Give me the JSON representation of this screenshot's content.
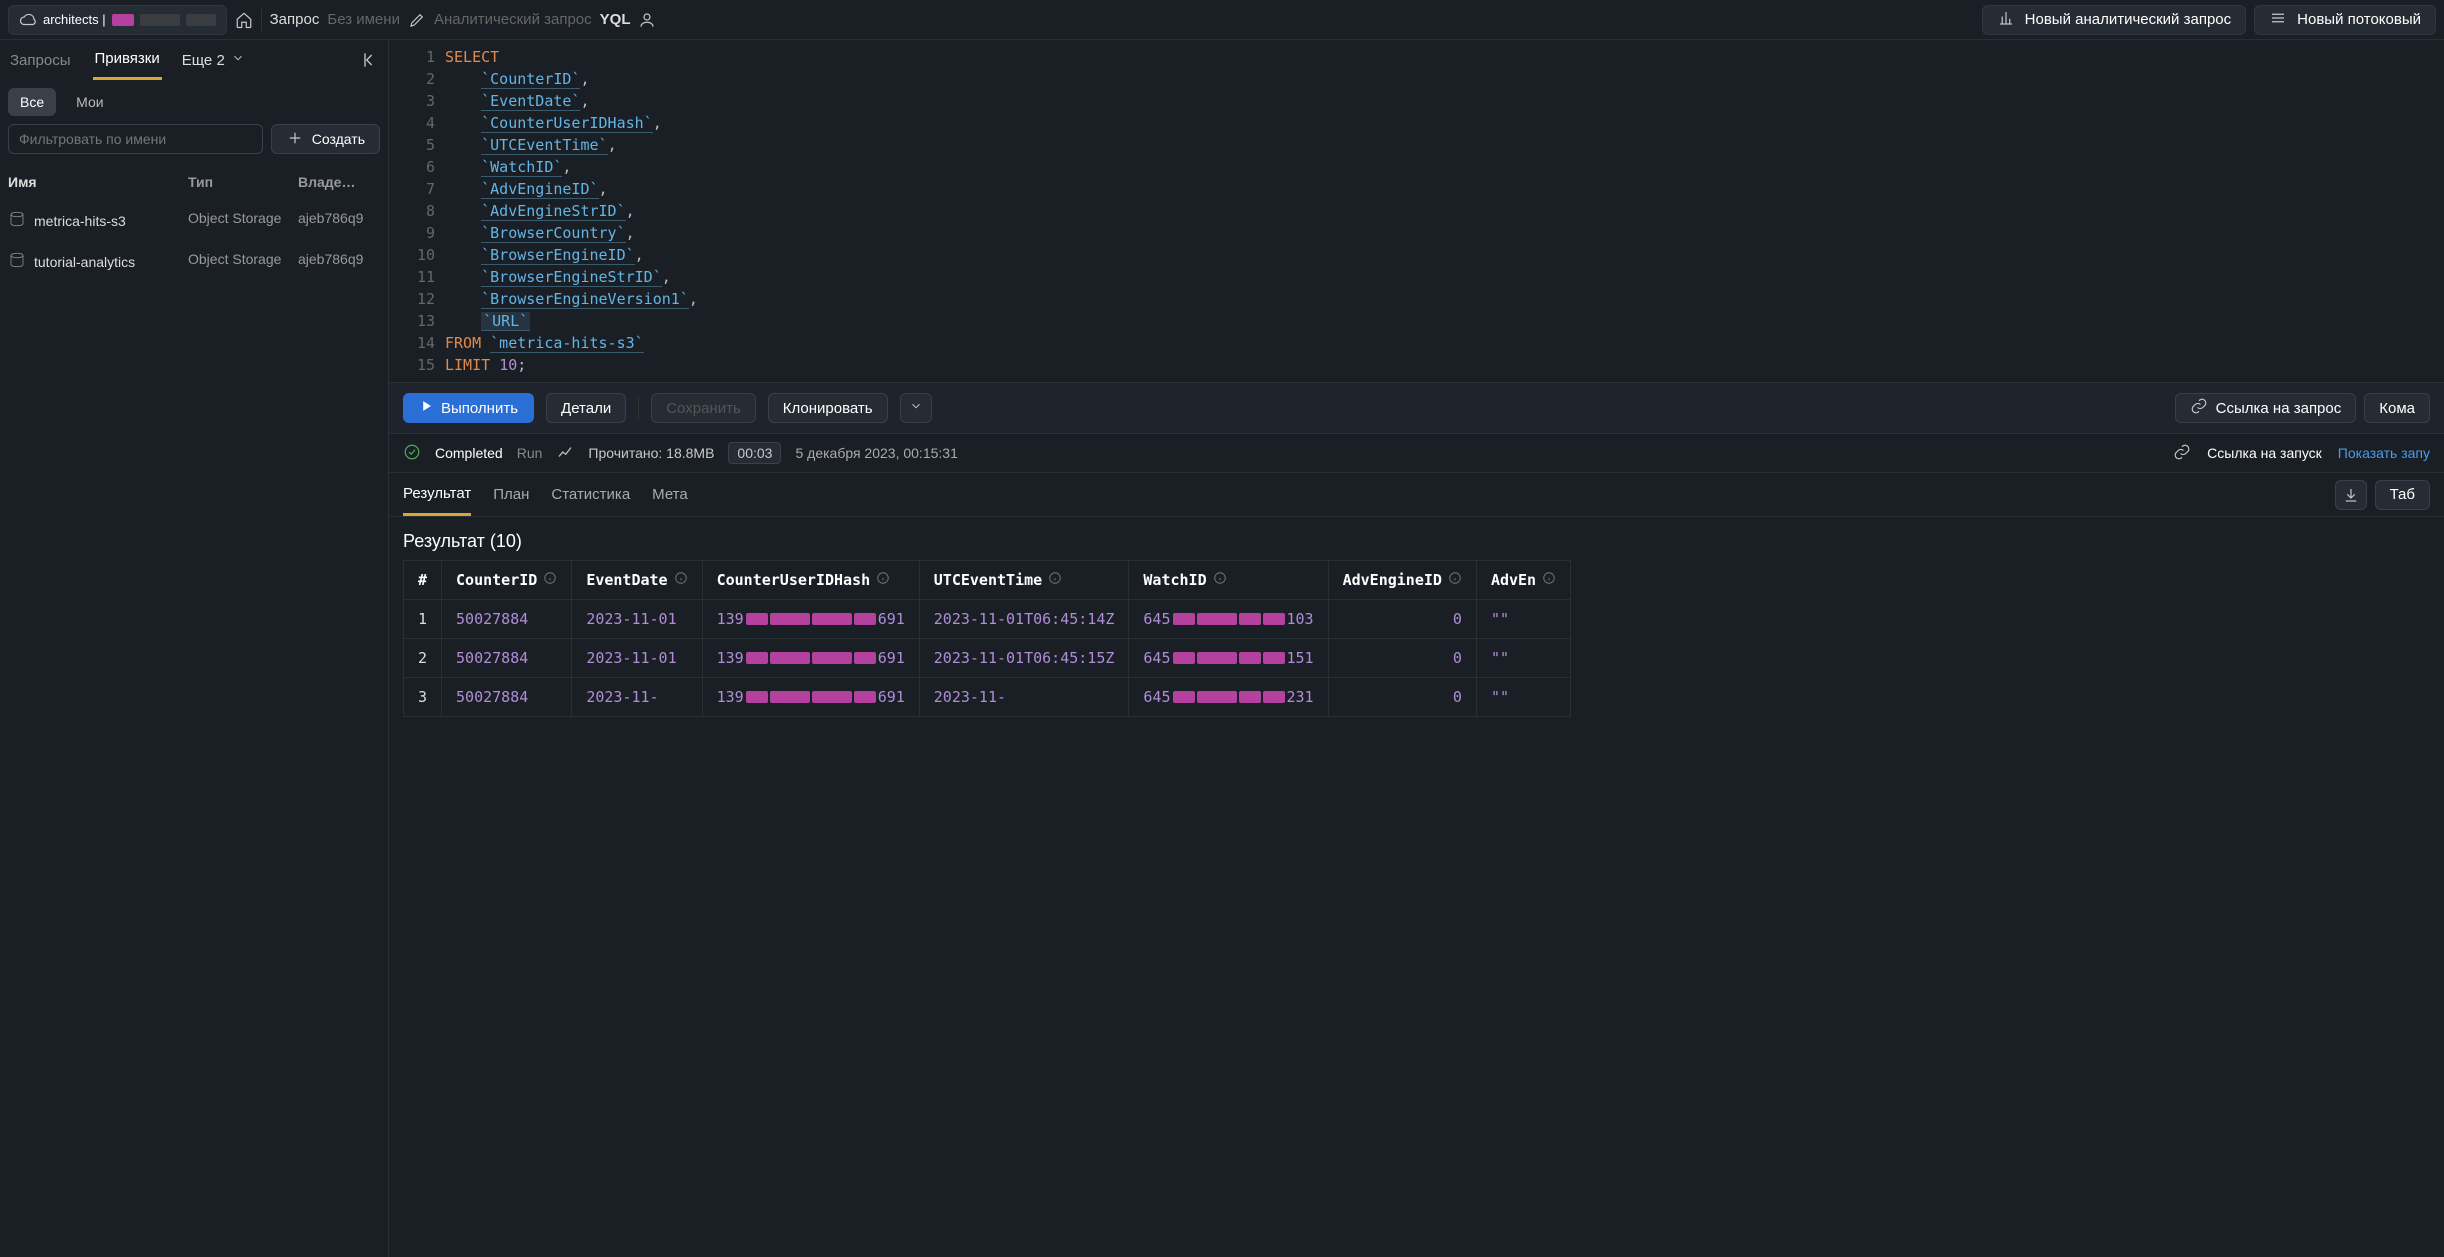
{
  "topbar": {
    "crumb_prefix": "architects |",
    "query_label": "Запрос",
    "untitled": "Без имени",
    "analytic": "Аналитический запрос",
    "lang": "YQL",
    "new_analytic": "Новый аналитический запрос",
    "new_stream": "Новый потоковый"
  },
  "sidebar": {
    "tabs": {
      "queries": "Запросы",
      "bindings": "Привязки",
      "more": "Еще 2"
    },
    "filters": {
      "all": "Все",
      "mine": "Мои"
    },
    "search_ph": "Фильтровать по имени",
    "create": "Создать",
    "head": {
      "name": "Имя",
      "type": "Тип",
      "owner": "Владе…"
    },
    "rows": [
      {
        "name": "metrica-hits-s3",
        "type": "Object Storage",
        "owner": "ajeb786q9"
      },
      {
        "name": "tutorial-analytics",
        "type": "Object Storage",
        "owner": "ajeb786q9"
      }
    ]
  },
  "editor": {
    "lines": [
      {
        "n": 1,
        "tokens": [
          {
            "t": "kw",
            "v": "SELECT"
          }
        ]
      },
      {
        "n": 2,
        "tokens": [
          {
            "t": "sp",
            "v": "    "
          },
          {
            "t": "ident",
            "v": "`CounterID`"
          },
          {
            "t": "punc",
            "v": ","
          }
        ]
      },
      {
        "n": 3,
        "tokens": [
          {
            "t": "sp",
            "v": "    "
          },
          {
            "t": "ident",
            "v": "`EventDate`"
          },
          {
            "t": "punc",
            "v": ","
          }
        ]
      },
      {
        "n": 4,
        "tokens": [
          {
            "t": "sp",
            "v": "    "
          },
          {
            "t": "ident",
            "v": "`CounterUserIDHash`"
          },
          {
            "t": "punc",
            "v": ","
          }
        ]
      },
      {
        "n": 5,
        "tokens": [
          {
            "t": "sp",
            "v": "    "
          },
          {
            "t": "ident",
            "v": "`UTCEventTime`"
          },
          {
            "t": "punc",
            "v": ","
          }
        ]
      },
      {
        "n": 6,
        "tokens": [
          {
            "t": "sp",
            "v": "    "
          },
          {
            "t": "ident",
            "v": "`WatchID`"
          },
          {
            "t": "punc",
            "v": ","
          }
        ]
      },
      {
        "n": 7,
        "tokens": [
          {
            "t": "sp",
            "v": "    "
          },
          {
            "t": "ident",
            "v": "`AdvEngineID`"
          },
          {
            "t": "punc",
            "v": ","
          }
        ]
      },
      {
        "n": 8,
        "tokens": [
          {
            "t": "sp",
            "v": "    "
          },
          {
            "t": "ident",
            "v": "`AdvEngineStrID`"
          },
          {
            "t": "punc",
            "v": ","
          }
        ]
      },
      {
        "n": 9,
        "tokens": [
          {
            "t": "sp",
            "v": "    "
          },
          {
            "t": "ident",
            "v": "`BrowserCountry`"
          },
          {
            "t": "punc",
            "v": ","
          }
        ]
      },
      {
        "n": 10,
        "tokens": [
          {
            "t": "sp",
            "v": "    "
          },
          {
            "t": "ident",
            "v": "`BrowserEngineID`"
          },
          {
            "t": "punc",
            "v": ","
          }
        ]
      },
      {
        "n": 11,
        "tokens": [
          {
            "t": "sp",
            "v": "    "
          },
          {
            "t": "ident",
            "v": "`BrowserEngineStrID`"
          },
          {
            "t": "punc",
            "v": ","
          }
        ]
      },
      {
        "n": 12,
        "tokens": [
          {
            "t": "sp",
            "v": "    "
          },
          {
            "t": "ident",
            "v": "`BrowserEngineVersion1`"
          },
          {
            "t": "punc",
            "v": ","
          }
        ]
      },
      {
        "n": 13,
        "tokens": [
          {
            "t": "sp",
            "v": "    "
          },
          {
            "t": "url",
            "v": "`URL`"
          }
        ]
      },
      {
        "n": 14,
        "tokens": [
          {
            "t": "kw",
            "v": "FROM "
          },
          {
            "t": "ident",
            "v": "`metrica-hits-s3`"
          }
        ]
      },
      {
        "n": 15,
        "tokens": [
          {
            "t": "kw",
            "v": "LIMIT "
          },
          {
            "t": "num",
            "v": "10"
          },
          {
            "t": "punc",
            "v": ";"
          }
        ]
      }
    ]
  },
  "actions": {
    "run": "Выполнить",
    "details": "Детали",
    "save": "Сохранить",
    "clone": "Клонировать",
    "query_link": "Ссылка на запрос",
    "command": "Кома"
  },
  "status": {
    "completed": "Completed",
    "mode": "Run",
    "read": "Прочитано: 18.8MB",
    "duration": "00:03",
    "when": "5 декабря 2023,  00:15:31",
    "run_link": "Ссылка на запуск",
    "show_run": "Показать запу"
  },
  "result_tabs": {
    "result": "Результат",
    "plan": "План",
    "stats": "Статистика",
    "meta": "Мета",
    "table_btn": "Таб"
  },
  "result_title": "Результат (10)",
  "table": {
    "cols": [
      "#",
      "CounterID",
      "EventDate",
      "CounterUserIDHash",
      "UTCEventTime",
      "WatchID",
      "AdvEngineID",
      "AdvEn"
    ],
    "rows": [
      {
        "idx": "1",
        "counter": "50027884",
        "date": "2023-11-01",
        "hash_pre": "139",
        "hash_suf": "691",
        "utc": "2023-11-01T06:45:14Z",
        "watch_pre": "645",
        "watch_suf": "103",
        "adv": "0",
        "adv2": "\"\""
      },
      {
        "idx": "2",
        "counter": "50027884",
        "date": "2023-11-01",
        "hash_pre": "139",
        "hash_suf": "691",
        "utc": "2023-11-01T06:45:15Z",
        "watch_pre": "645",
        "watch_suf": "151",
        "adv": "0",
        "adv2": "\"\""
      },
      {
        "idx": "3",
        "counter": "50027884",
        "date": "2023-11-",
        "hash_pre": "139",
        "hash_suf": "691",
        "utc": "2023-11-",
        "watch_pre": "645",
        "watch_suf": "231",
        "adv": "0",
        "adv2": "\"\""
      }
    ]
  }
}
